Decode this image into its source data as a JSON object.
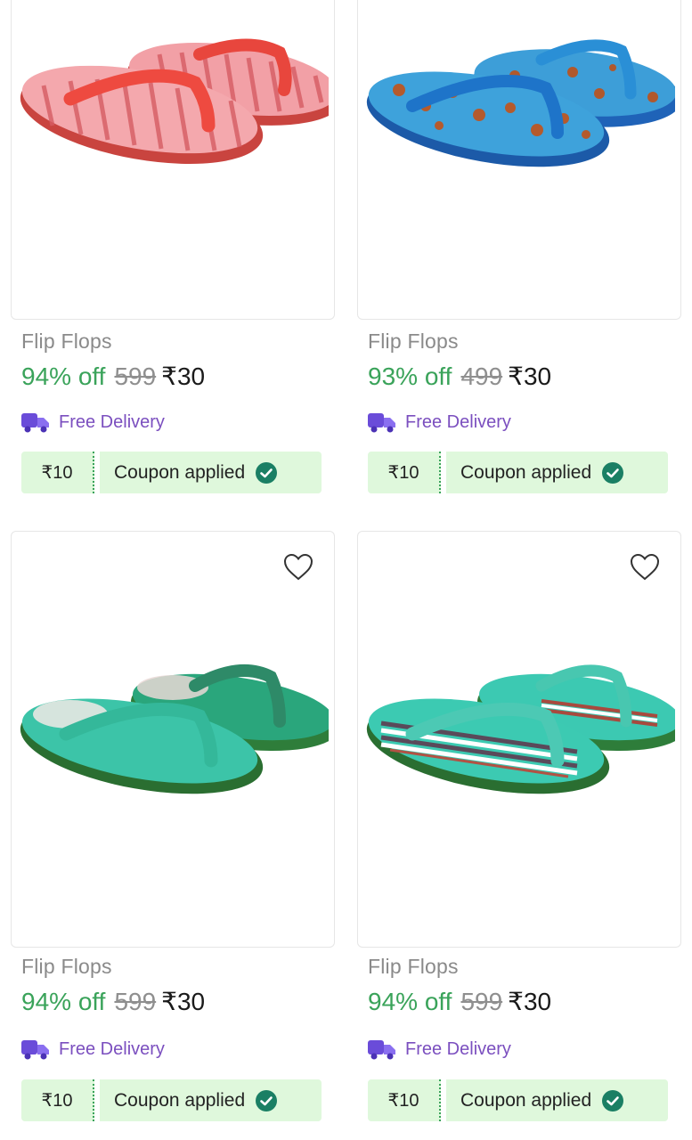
{
  "colors": {
    "discount_green": "#3aa35a",
    "coupon_bg": "#dff8dc",
    "delivery_purple": "#7b4fbf",
    "check_teal": "#1a7f64"
  },
  "products": [
    {
      "title": "Flip Flops",
      "discount": "94% off",
      "mrp": "599",
      "price": "₹30",
      "delivery": "Free Delivery",
      "coupon_amount": "₹10",
      "coupon_label": "Coupon applied",
      "icons": {
        "truck": "truck-icon",
        "check": "check-circle-icon"
      }
    },
    {
      "title": "Flip Flops",
      "discount": "93% off",
      "mrp": "499",
      "price": "₹30",
      "delivery": "Free Delivery",
      "coupon_amount": "₹10",
      "coupon_label": "Coupon applied",
      "icons": {
        "truck": "truck-icon",
        "check": "check-circle-icon"
      }
    },
    {
      "title": "Flip Flops",
      "discount": "94% off",
      "mrp": "599",
      "price": "₹30",
      "delivery": "Free Delivery",
      "coupon_amount": "₹10",
      "coupon_label": "Coupon applied",
      "icons": {
        "heart": "heart-icon",
        "truck": "truck-icon",
        "check": "check-circle-icon"
      }
    },
    {
      "title": "Flip Flops",
      "discount": "94% off",
      "mrp": "599",
      "price": "₹30",
      "delivery": "Free Delivery",
      "coupon_amount": "₹10",
      "coupon_label": "Coupon applied",
      "icons": {
        "heart": "heart-icon",
        "truck": "truck-icon",
        "check": "check-circle-icon"
      }
    }
  ]
}
